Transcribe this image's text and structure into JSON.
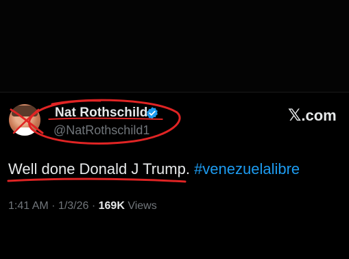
{
  "tweet": {
    "display_name": "Nat Rothschild",
    "handle": "@NatRothschild1",
    "source": ".com",
    "text_plain": "Well done Donald J Trump. ",
    "text_hashtag": "#venezuelalibre",
    "time": "1:41 AM",
    "date": "1/3/26",
    "separator": " · ",
    "views_count": "169K",
    "views_label": " Views"
  },
  "icons": {
    "verified": "verified-badge-icon",
    "brand": "x-logo-icon"
  },
  "colors": {
    "background": "#000000",
    "text": "#e7e9ea",
    "muted": "#71767b",
    "accent": "#1d9bf0",
    "annotation": "#e02424"
  }
}
